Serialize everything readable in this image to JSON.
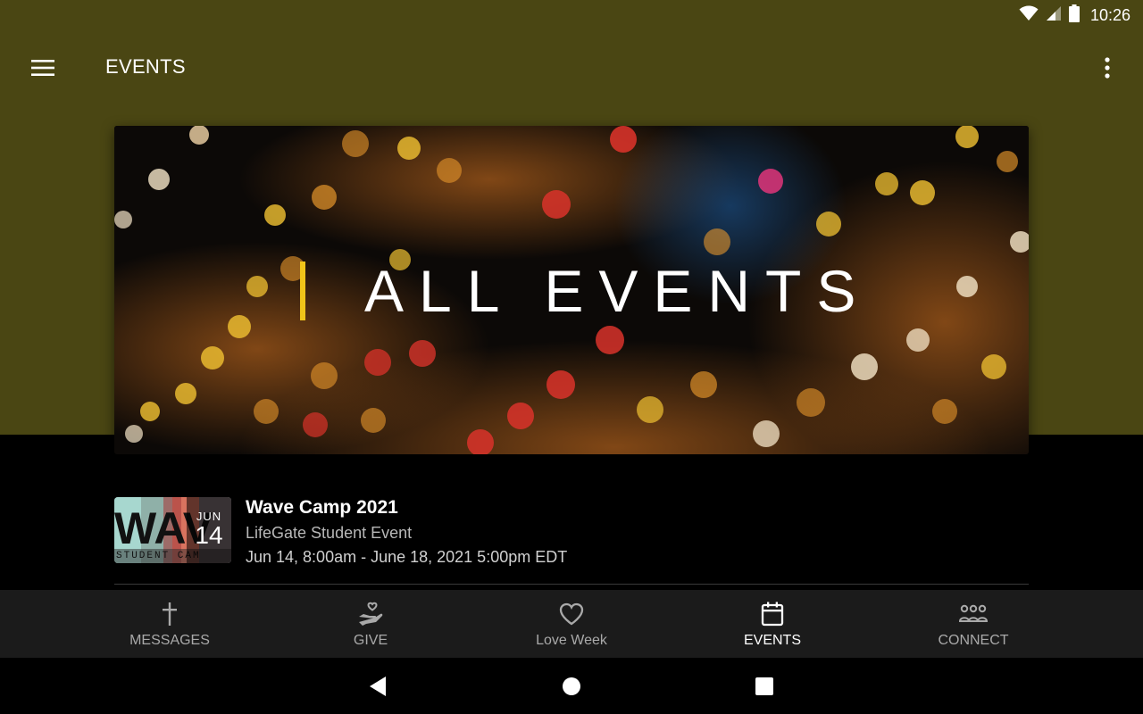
{
  "status_bar": {
    "time": "10:26",
    "icons": [
      "wifi-icon",
      "cell-signal-icon",
      "battery-icon"
    ]
  },
  "app_bar": {
    "title": "EVENTS",
    "menu_icon": "hamburger-menu-icon",
    "overflow_icon": "more-vert-icon",
    "background_color": "#4a4613"
  },
  "hero": {
    "title": "ALL EVENTS",
    "accent_color": "#f0c419"
  },
  "events": [
    {
      "title": "Wave Camp 2021",
      "subtitle": "LifeGate Student Event",
      "when": "Jun 14, 8:00am - June 18, 2021 5:00pm EDT",
      "thumb_month": "JUN",
      "thumb_day": "14",
      "thumb_art_text": "WAV",
      "thumb_art_subtext": "STUDENT CAM"
    }
  ],
  "bottom_nav": {
    "items": [
      {
        "label": "MESSAGES",
        "icon": "cross-icon"
      },
      {
        "label": "GIVE",
        "icon": "give-hand-heart-icon"
      },
      {
        "label": "Love Week",
        "icon": "heart-icon"
      },
      {
        "label": "EVENTS",
        "icon": "calendar-icon"
      },
      {
        "label": "CONNECT",
        "icon": "people-group-icon"
      }
    ],
    "active": "EVENTS"
  },
  "system_nav": [
    "back-icon",
    "home-icon",
    "recents-icon"
  ]
}
